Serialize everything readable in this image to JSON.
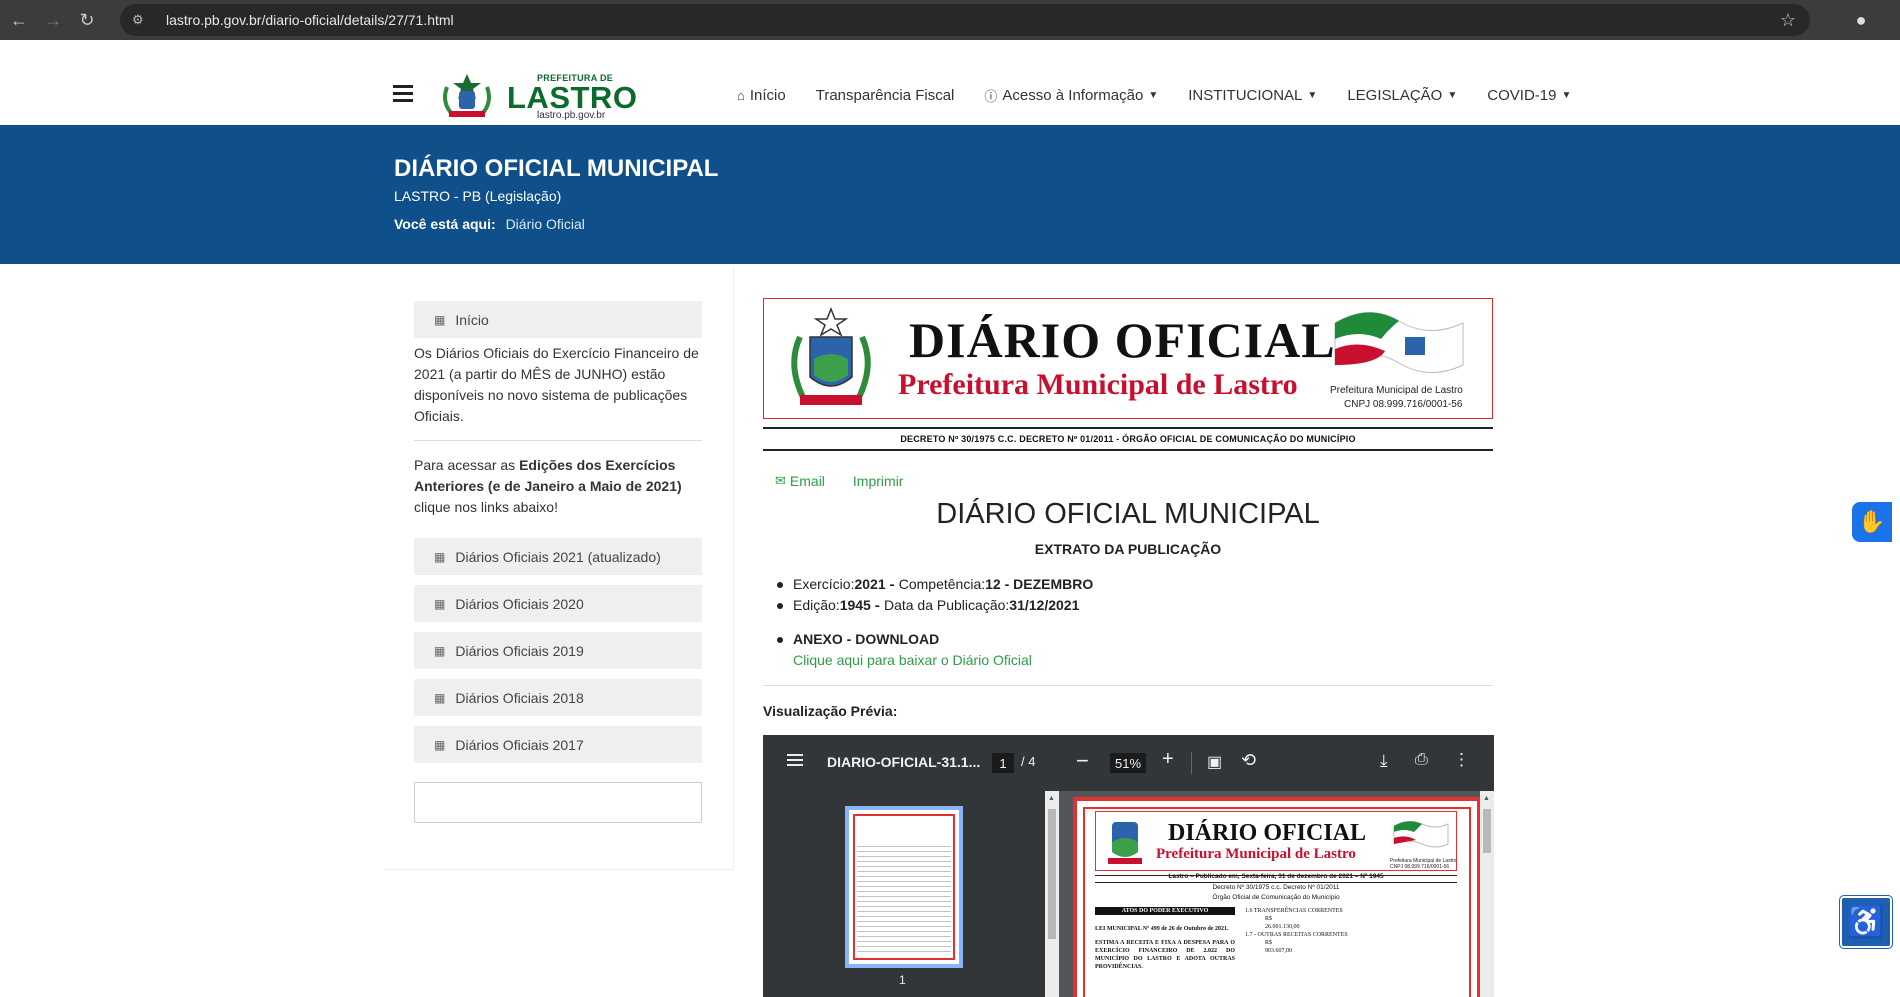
{
  "browser": {
    "url": "lastro.pb.gov.br/diario-oficial/details/27/71.html"
  },
  "header": {
    "logo": {
      "prefeitura": "PREFEITURA DE",
      "name": "LASTRO",
      "site": "lastro.pb.gov.br"
    },
    "nav": [
      {
        "label": "Início",
        "icon": "home-icon"
      },
      {
        "label": "Transparência Fiscal"
      },
      {
        "label": "Acesso à Informação",
        "icon": "info-icon",
        "dropdown": true
      },
      {
        "label": "INSTITUCIONAL",
        "dropdown": true
      },
      {
        "label": "LEGISLAÇÃO",
        "dropdown": true
      },
      {
        "label": "COVID-19",
        "dropdown": true
      }
    ]
  },
  "banner": {
    "title": "DIÁRIO OFICIAL MUNICIPAL",
    "subtitle": "LASTRO - PB (Legislação)",
    "breadcrumb_label": "Você está aqui:",
    "breadcrumb_link": "Diário Oficial"
  },
  "sidebar": {
    "home_button": "Início",
    "notice1": "Os Diários Oficiais do Exercício Financeiro de 2021 (a partir do MÊS de JUNHO) estão disponíveis no novo sistema de publicações Oficiais.",
    "notice2_prefix": "Para acessar as ",
    "notice2_bold": "Edições dos Exercícios Anteriores (e de Janeiro a Maio de 2021)",
    "notice2_suffix": " clique nos links abaixo!",
    "links": [
      "Diários Oficiais 2021 (atualizado)",
      "Diários Oficiais 2020",
      "Diários Oficiais 2019",
      "Diários Oficiais 2018",
      "Diários Oficiais 2017"
    ]
  },
  "masthead": {
    "title": "DIÁRIO OFICIAL",
    "subtitle": "Prefeitura Municipal de Lastro",
    "flag_caption": "Prefeitura Municipal de Lastro",
    "cnpj": "CNPJ 08.999.716/0001-56",
    "decreto": "DECRETO Nº 30/1975 C.C. DECRETO Nº 01/2011 - ÓRGÃO OFICIAL DE COMUNICAÇÃO DO MUNICÍPIO"
  },
  "actions": {
    "email": "Email",
    "print": "Imprimir"
  },
  "publication": {
    "title": "DIÁRIO OFICIAL MUNICIPAL",
    "subtitle": "EXTRATO DA PUBLICAÇÃO",
    "exercicio_label": "Exercício: ",
    "exercicio": "2021",
    "competencia_label": " - Competência: ",
    "competencia": "12 - DEZEMBRO",
    "edicao_label": "Edição: ",
    "edicao": "1945",
    "data_label": " - Data da Publicação: ",
    "data": "31/12/2021",
    "anexo": "ANEXO - DOWNLOAD",
    "download_link": "Clique aqui para baixar o Diário Oficial",
    "preview_label": "Visualização Prévia:"
  },
  "pdf_viewer": {
    "filename": "DIARIO-OFICIAL-31.1...",
    "page": "1",
    "total": "/  4",
    "zoom": "51%",
    "thumb_number": "1",
    "page_content": {
      "title": "DIÁRIO OFICIAL",
      "subtitle": "Prefeitura Municipal de Lastro",
      "flag_caption": "Prefeitura Municipal de Lastro\nCNPJ 08.999.716/0001-56",
      "published": "Lastro – Publicado em, Sexta-feira, 31 de dezembro de 2021 – Nº 1945",
      "decreto": "Decreto Nº 30/1975 c.c. Decreto Nº 01/2011",
      "orgao": "Órgão Oficial de Comunicação do Município",
      "atos": "ATOS DO PODER EXECUTIVO",
      "lei": "LEI MUNICIPAL Nº 499 de 26 de Outubro de 2021.",
      "ementa": "ESTIMA A RECEITA E FIXA A DESPESA PARA O EXERCÍCIO FINANCEIRO DE 2.022 DO MUNICÍPIO DO LASTRO E ADOTA OUTRAS PROVIDÊNCIAS.",
      "col2_line1": "1.6  TRANSFERÊNCIAS          CORRENTES",
      "col2_line2": "R$",
      "col2_line3": "26.001.130,00",
      "col2_line4": "1.7 -        OUTRAS        RECEITAS         CORRENTES",
      "col2_line5": "R$",
      "col2_line6": "903.607,00"
    }
  }
}
